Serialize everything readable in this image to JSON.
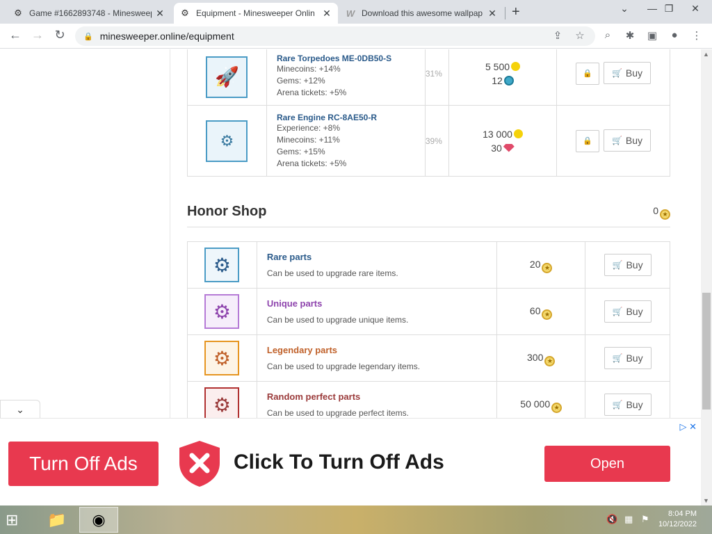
{
  "browser": {
    "tabs": [
      {
        "title": "Game #1662893748 - Minesweep",
        "active": false,
        "icon": "gear-icon"
      },
      {
        "title": "Equipment - Minesweeper Onlin",
        "active": true,
        "icon": "gear-icon"
      },
      {
        "title": "Download this awesome wallpap",
        "active": false,
        "icon": "w-icon"
      }
    ],
    "url": "minesweeper.online/equipment"
  },
  "equipment": [
    {
      "name": "Rare Torpedoes ME-0DB50-S",
      "stats": [
        "Minecoins: +14%",
        "Gems: +12%",
        "Arena tickets: +5%"
      ],
      "percent": "31%",
      "price_coins": "5 500",
      "price_gems": "12",
      "gem_type": "aquamarine",
      "icon": "rocket-icon",
      "buy_label": "Buy"
    },
    {
      "name": "Rare Engine RC-8AE50-R",
      "stats": [
        "Experience: +8%",
        "Minecoins: +11%",
        "Gems: +15%",
        "Arena tickets: +5%"
      ],
      "percent": "39%",
      "price_coins": "13 000",
      "price_gems": "30",
      "gem_type": "ruby",
      "icon": "engine-icon",
      "buy_label": "Buy"
    }
  ],
  "honor_shop": {
    "title": "Honor Shop",
    "balance": "0",
    "items": [
      {
        "name": "Rare parts",
        "desc": "Can be used to upgrade rare items.",
        "price": "20",
        "color": "#2a5a8a",
        "border": "#4a9bc5",
        "buy_label": "Buy"
      },
      {
        "name": "Unique parts",
        "desc": "Can be used to upgrade unique items.",
        "price": "60",
        "color": "#8e44ad",
        "border": "#b57ad6",
        "buy_label": "Buy"
      },
      {
        "name": "Legendary parts",
        "desc": "Can be used to upgrade legendary items.",
        "price": "300",
        "color": "#c0612a",
        "border": "#e69520",
        "buy_label": "Buy"
      },
      {
        "name": "Random perfect parts",
        "desc": "Can be used to upgrade perfect items.",
        "price": "50 000",
        "color": "#9a3a3a",
        "border": "#b03030",
        "buy_label": "Buy"
      }
    ]
  },
  "ad": {
    "turn_off": "Turn Off Ads",
    "message": "Click To Turn Off Ads",
    "open": "Open"
  },
  "taskbar": {
    "time": "8:04 PM",
    "date": "10/12/2022"
  }
}
